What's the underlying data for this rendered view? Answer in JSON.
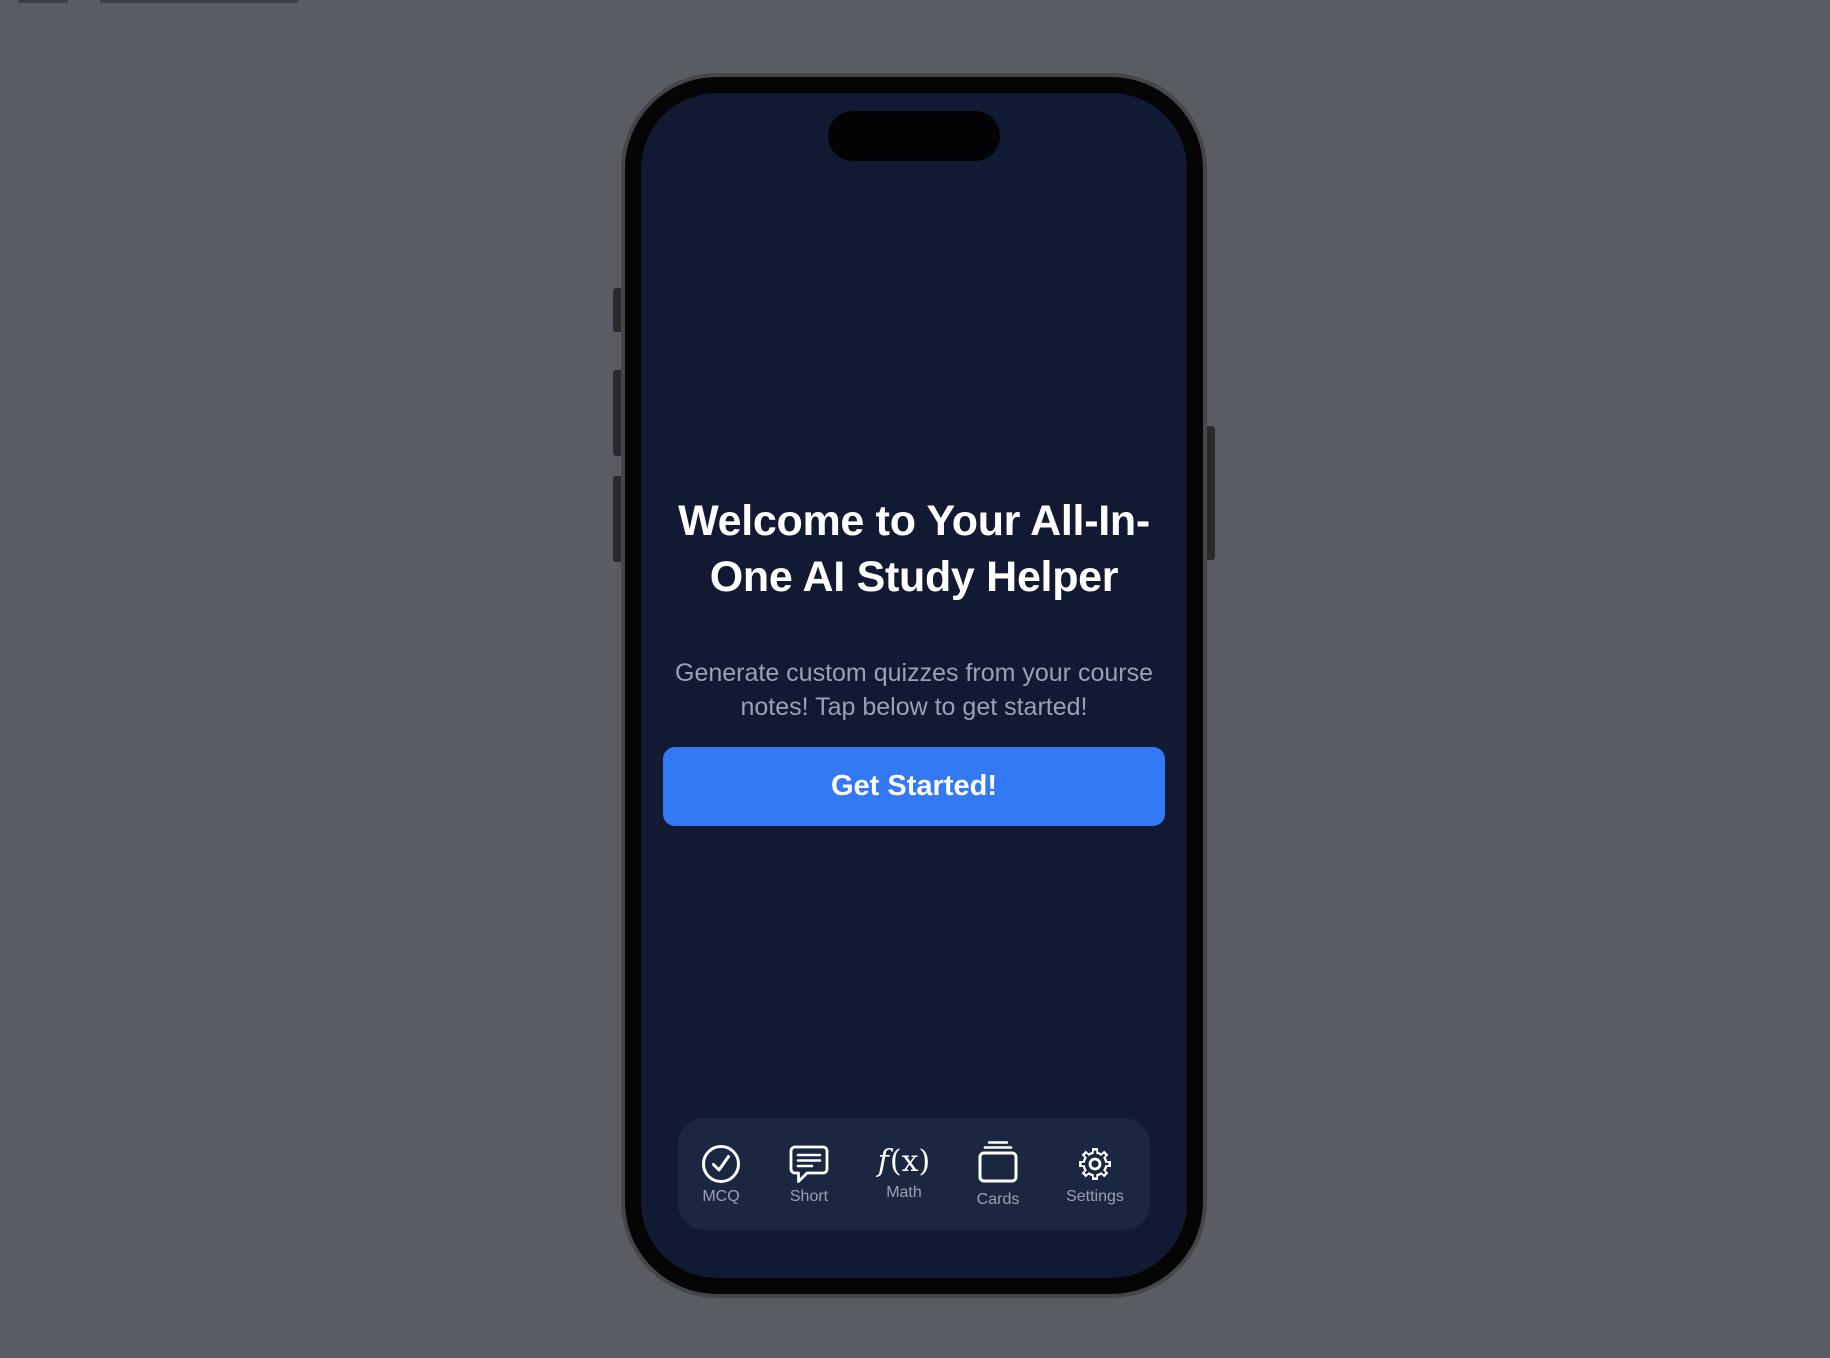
{
  "welcome": {
    "title": "Welcome to Your All-In-One AI Study Helper",
    "subtitle": "Generate custom quizzes from your course notes! Tap below to get started!",
    "cta_label": "Get Started!"
  },
  "tab_bar": {
    "items": [
      {
        "label": "MCQ",
        "icon": "checkmark-circle-icon"
      },
      {
        "label": "Short",
        "icon": "text-bubble-icon"
      },
      {
        "label": "Math",
        "icon": "function-icon"
      },
      {
        "label": "Cards",
        "icon": "card-stack-icon"
      },
      {
        "label": "Settings",
        "icon": "gear-icon"
      }
    ]
  },
  "colors": {
    "desktop_background": "#595c63",
    "screen_background": "#111a32",
    "tab_bar_background": "#1b2641",
    "accent": "#3479f4",
    "title_text": "#ffffff",
    "subtitle_text": "#9aa2b1",
    "tab_label_text": "#9aa1af"
  }
}
